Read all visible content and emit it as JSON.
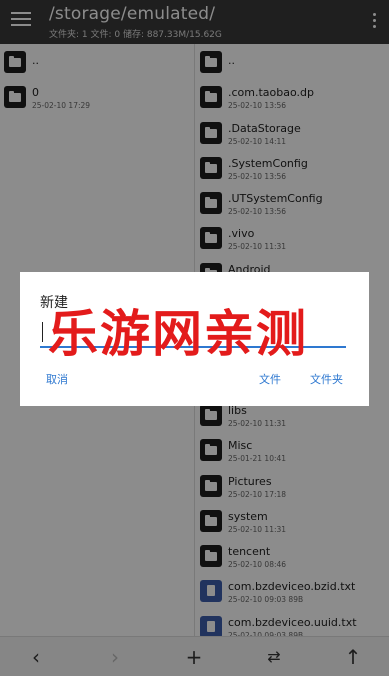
{
  "header": {
    "title": "/storage/emulated/",
    "subtitle": "文件夹: 1  文件: 0  储存: 887.33M/15.62G"
  },
  "left_pane": {
    "items": [
      {
        "name": "..",
        "date": "",
        "type": "folder"
      },
      {
        "name": "0",
        "date": "25-02-10 17:29",
        "type": "folder"
      }
    ]
  },
  "right_pane": {
    "items": [
      {
        "name": "..",
        "date": "",
        "type": "folder"
      },
      {
        "name": ".com.taobao.dp",
        "date": "25-02-10 13:56",
        "type": "folder"
      },
      {
        "name": ".DataStorage",
        "date": "25-02-10 14:11",
        "type": "folder"
      },
      {
        "name": ".SystemConfig",
        "date": "25-02-10 13:56",
        "type": "folder"
      },
      {
        "name": ".UTSystemConfig",
        "date": "25-02-10 13:56",
        "type": "folder"
      },
      {
        "name": ".vivo",
        "date": "25-02-10 11:31",
        "type": "folder"
      },
      {
        "name": "Android",
        "date": "",
        "type": "folder"
      },
      {
        "name": "",
        "date": "",
        "type": "folder"
      },
      {
        "name": "",
        "date": "",
        "type": "folder"
      },
      {
        "name": "",
        "date": "",
        "type": "folder"
      },
      {
        "name": "libs",
        "date": "25-02-10 11:31",
        "type": "folder"
      },
      {
        "name": "Misc",
        "date": "25-01-21 10:41",
        "type": "folder"
      },
      {
        "name": "Pictures",
        "date": "25-02-10 17:18",
        "type": "folder"
      },
      {
        "name": "system",
        "date": "25-02-10 11:31",
        "type": "folder"
      },
      {
        "name": "tencent",
        "date": "25-02-10 08:46",
        "type": "folder"
      },
      {
        "name": "com.bzdeviceo.bzid.txt",
        "date": "25-02-10 09:03  89B",
        "type": "file"
      },
      {
        "name": "com.bzdeviceo.uuid.txt",
        "date": "25-02-10 09:03  89B",
        "type": "file"
      }
    ]
  },
  "dialog": {
    "title": "新建",
    "input_value": "",
    "cancel_label": "取消",
    "file_label": "文件",
    "folder_label": "文件夹"
  },
  "watermark": "乐游网亲测",
  "bottom_bar": {
    "icons": [
      "back-icon",
      "forward-icon",
      "add-icon",
      "swap-icon",
      "up-icon"
    ]
  },
  "colors": {
    "topbar": "#3a3a3a",
    "accent": "#2e78d0",
    "watermark": "#e31b1b",
    "file_icon": "#3c5dab"
  }
}
